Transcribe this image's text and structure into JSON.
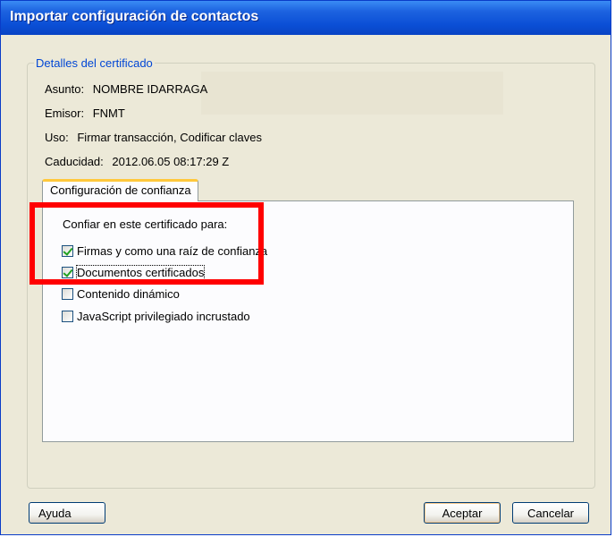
{
  "window": {
    "title": "Importar configuración de contactos"
  },
  "details": {
    "legend": "Detalles del certificado",
    "subject_label": "Asunto:",
    "subject_value": "NOMBRE IDARRAGA",
    "issuer_label": "Emisor:",
    "issuer_value": "FNMT",
    "usage_label": "Uso:",
    "usage_value": "Firmar transacción, Codificar claves",
    "expiry_label": "Caducidad:",
    "expiry_value": "2012.06.05 08:17:29 Z"
  },
  "tabs": [
    {
      "label": "Configuración de confianza"
    }
  ],
  "trust": {
    "label": "Confiar en este certificado para:",
    "options": [
      {
        "label": "Firmas y como una raíz de confianza",
        "checked": true
      },
      {
        "label": "Documentos certificados",
        "checked": true
      },
      {
        "label": "Contenido dinámico",
        "checked": false
      },
      {
        "label": "JavaScript privilegiado incrustado",
        "checked": false
      }
    ]
  },
  "buttons": {
    "help": "Ayuda",
    "ok": "Aceptar",
    "cancel": "Cancelar"
  },
  "colors": {
    "titlebar": "#0b4fd6",
    "highlight": "#ff0000",
    "legend": "#0046d5"
  }
}
